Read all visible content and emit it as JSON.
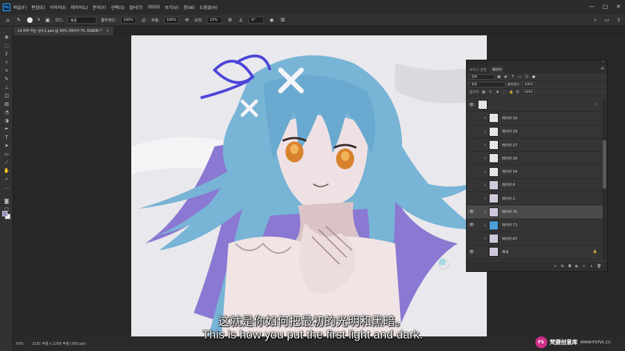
{
  "menubar": {
    "logo": "Ps",
    "items": [
      "파일(F)",
      "편집(E)",
      "이미지(I)",
      "레이어(L)",
      "문자(Y)",
      "선택(S)",
      "필터(T)",
      "3D(D)",
      "보기(V)",
      "창(W)",
      "도움말(H)"
    ],
    "window_controls": [
      "—",
      "□",
      "✕"
    ]
  },
  "options": {
    "brush_size": "9",
    "mode_label": "모드:",
    "mode_value": "표준",
    "opacity_label": "불투명도:",
    "opacity_value": "100%",
    "flow_label": "흐름:",
    "flow_value": "100%",
    "smoothing_label": "보정:",
    "smoothing_value": "10%",
    "angle_value": "0°"
  },
  "document": {
    "tab_title": "14.자주 하는 실수1.psd @ 50% (레이어 75, RGB/8) *",
    "close": "×"
  },
  "status": {
    "zoom": "50%",
    "doc_info": "2181 픽셀 x 2256 픽셀 (300 ppi)"
  },
  "layers_panel": {
    "tabs": [
      "브러시 설정",
      "레이어"
    ],
    "active_tab": "레이어",
    "filter_kind": "종류",
    "blend_mode": "표준",
    "opacity_label": "불투명도:",
    "opacity_value": "100%",
    "lock_label": "잠그기:",
    "fill_label": "칠:",
    "fill_value": "100%",
    "layers": [
      {
        "name": "",
        "visible": true,
        "thumb": "empty",
        "selected": false,
        "locked": false
      },
      {
        "name": "레이어 30",
        "visible": false,
        "thumb": "empty",
        "selected": false,
        "locked": false
      },
      {
        "name": "레이어 29",
        "visible": false,
        "thumb": "empty",
        "selected": false,
        "locked": false
      },
      {
        "name": "레이어 27",
        "visible": false,
        "thumb": "empty",
        "selected": false,
        "locked": false
      },
      {
        "name": "레이어 26",
        "visible": false,
        "thumb": "empty",
        "selected": false,
        "locked": false
      },
      {
        "name": "레이어 14",
        "visible": false,
        "thumb": "empty",
        "selected": false,
        "locked": false
      },
      {
        "name": "레이어 6",
        "visible": false,
        "thumb": "art",
        "selected": false,
        "locked": false
      },
      {
        "name": "레이어 2",
        "visible": false,
        "thumb": "art",
        "selected": false,
        "locked": false
      },
      {
        "name": "레이어 75",
        "visible": true,
        "thumb": "art",
        "selected": true,
        "locked": false
      },
      {
        "name": "레이어 71",
        "visible": true,
        "thumb": "blue",
        "selected": false,
        "locked": false
      },
      {
        "name": "레이어 67",
        "visible": false,
        "thumb": "art",
        "selected": false,
        "locked": false
      },
      {
        "name": "채색",
        "visible": true,
        "thumb": "art",
        "selected": false,
        "locked": true
      }
    ],
    "footer_buttons": [
      "∞",
      "fx",
      "◘",
      "◐",
      "▭",
      "+",
      "🗑"
    ]
  },
  "subtitles": {
    "chinese": "这就是你如何把最初的光明和黑暗。",
    "english": "This is how you put the first light and dark."
  },
  "watermark": {
    "logo": "FS",
    "name": "梵摄创意库",
    "url": "WWW.FSTVC.CC"
  },
  "colors": {
    "foreground": "#9a8fc4",
    "background": "#f2f2f2",
    "hair": "#78b4d6",
    "hair_shadow": "#8a78d2",
    "ribbon": "#4b45d8"
  }
}
